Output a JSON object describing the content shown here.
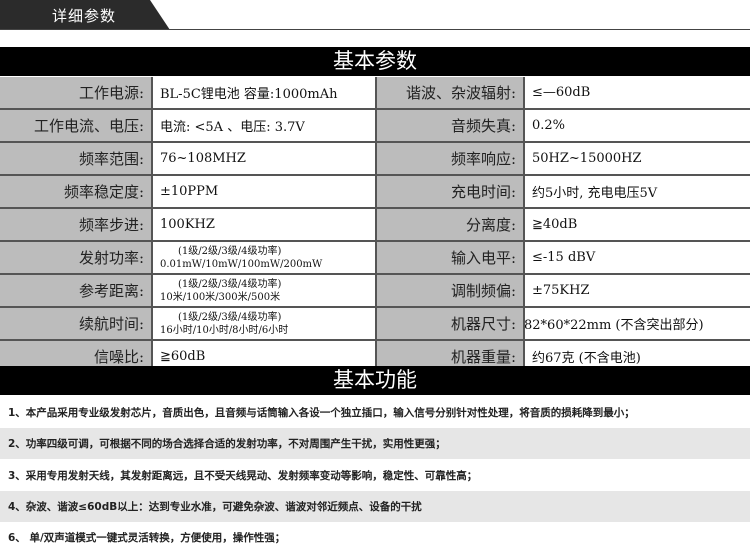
{
  "header_tab": "详细参数",
  "spec_title": "基本参数",
  "func_title": "基本功能",
  "specs": [
    {
      "l1": "工作电源:",
      "v1": "BL-5C锂电池 容量:1000mAh",
      "l2": "谐波、杂波辐射:",
      "v2": "≤—60dB"
    },
    {
      "l1": "工作电流、电压:",
      "v1": "电流: <5A 、电压: 3.7V",
      "l2": "音频失真:",
      "v2": "0.2%"
    },
    {
      "l1": "频率范围:",
      "v1": "76~108MHZ",
      "l2": "频率响应:",
      "v2": "50HZ~15000HZ"
    },
    {
      "l1": "频率稳定度:",
      "v1": "±10PPM",
      "l2": "充电时间:",
      "v2": "约5小时, 充电电压5V"
    },
    {
      "l1": "频率步进:",
      "v1": "100KHZ",
      "l2": "分离度:",
      "v2": "≧40dB"
    },
    {
      "l1": "发射功率:",
      "v1a": "(1级/2级/3级/4级功率)",
      "v1b": "0.01mW/10mW/100mW/200mW",
      "l2": "输入电平:",
      "v2": "≤-15 dBV"
    },
    {
      "l1": "参考距离:",
      "v1a": "(1级/2级/3级/4级功率)",
      "v1b": "10米/100米/300米/500米",
      "l2": "调制频偏:",
      "v2": "±75KHZ"
    },
    {
      "l1": "续航时间:",
      "v1a": "(1级/2级/3级/4级功率)",
      "v1b": "16小时/10小时/8小时/6小时",
      "l2": "机器尺寸:",
      "v2": "82*60*22mm (不含突出部分)"
    },
    {
      "l1": "信噪比:",
      "v1": "≧60dB",
      "l2": "机器重量:",
      "v2": "约67克 (不含电池)"
    }
  ],
  "features": [
    "1、本产品采用专业级发射芯片，音质出色，且音频与话筒输入各设一个独立插口，输入信号分别针对性处理，将音质的损耗降到最小；",
    "2、功率四级可调，可根据不同的场合选择合适的发射功率，不对周围产生干扰，实用性更强；",
    "3、采用专用发射天线，其发射距离远，且不受天线晃动、发射频率变动等影响，稳定性、可靠性高；",
    "4、杂波、谐波≤60dB以上：达到专业水准，可避免杂波、谐波对邻近频点、设备的干扰",
    "6、 单/双声道模式一键式灵活转换，方便使用，操作性强；"
  ]
}
